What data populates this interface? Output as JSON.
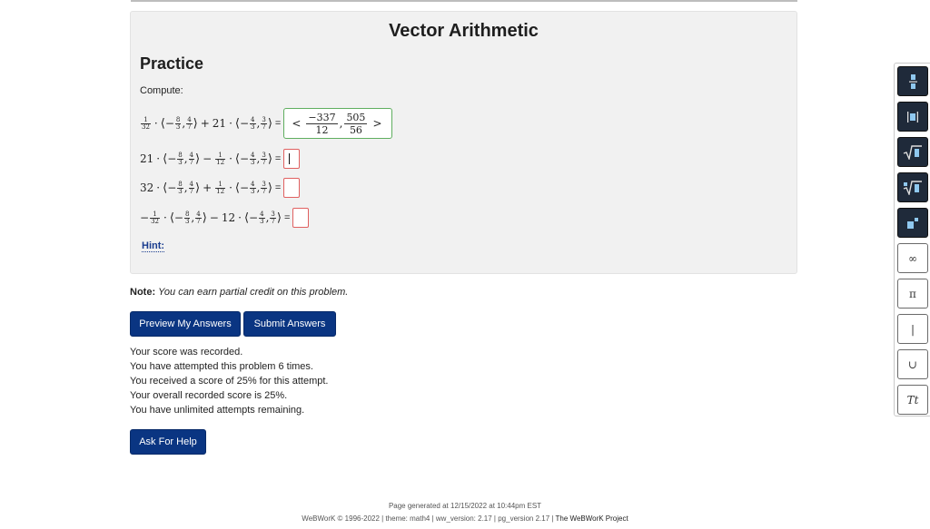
{
  "page": {
    "title": "Vector Arithmetic",
    "section": "Practice",
    "instruction": "Compute:",
    "hint_label": "Hint:",
    "note_label": "Note:",
    "note_text": "You can earn partial credit on this problem."
  },
  "problems": [
    {
      "answer_num1": "−337",
      "answer_den1": "12",
      "answer_num2": "505",
      "answer_den2": "56",
      "status": "correct"
    },
    {
      "status": "active"
    },
    {
      "status": "empty"
    },
    {
      "status": "empty"
    }
  ],
  "buttons": {
    "preview": "Preview My Answers",
    "submit": "Submit Answers",
    "help": "Ask For Help"
  },
  "status_messages": [
    "Your score was recorded.",
    "You have attempted this problem 6 times.",
    "You received a score of 25% for this attempt.",
    "Your overall recorded score is 25%.",
    "You have unlimited attempts remaining."
  ],
  "footer": {
    "generated": "Page generated at 12/15/2022 at 10:44pm EST",
    "copyright": "WeBWorK © 1996-2022 | theme: math4 | ww_version: 2.17 | pg_version 2.17 |",
    "project_link": "The WeBWorK Project"
  },
  "toolbar": [
    {
      "icon": "fraction-icon",
      "label": ""
    },
    {
      "icon": "absolute-value-icon",
      "label": ""
    },
    {
      "icon": "square-root-icon",
      "label": ""
    },
    {
      "icon": "nth-root-icon",
      "label": ""
    },
    {
      "icon": "exponent-icon",
      "label": ""
    },
    {
      "icon": "infinity-icon",
      "label": "∞"
    },
    {
      "icon": "pi-icon",
      "label": "π"
    },
    {
      "icon": "vertical-bar-icon",
      "label": "|"
    },
    {
      "icon": "union-icon",
      "label": "∪"
    },
    {
      "icon": "text-icon",
      "label": "Tt"
    }
  ],
  "colors": {
    "button_bg": "#0a3582",
    "correct_border": "#5fae5f",
    "empty_border": "#e06060",
    "toolbar_dark": "#1f2a3a"
  }
}
